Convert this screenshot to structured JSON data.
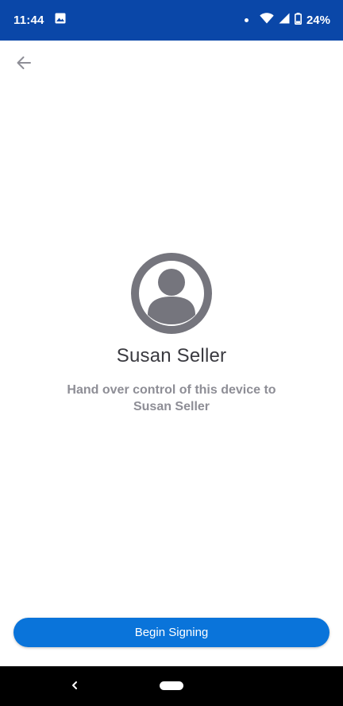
{
  "status_bar": {
    "time": "11:44",
    "battery": "24%",
    "icons": [
      "image-icon",
      "wifi-icon",
      "signal-icon",
      "battery-icon"
    ],
    "background": "#0a47a8"
  },
  "header": {
    "back_icon": "arrow-left-icon"
  },
  "main": {
    "avatar_icon": "user-avatar-icon",
    "signer_name": "Susan Seller",
    "instruction": "Hand over control of this device to Susan Seller"
  },
  "footer": {
    "begin_label": "Begin Signing",
    "button_color": "#0a74da"
  },
  "nav_bar": {
    "back_icon": "nav-back-icon",
    "home_icon": "nav-home-pill"
  }
}
